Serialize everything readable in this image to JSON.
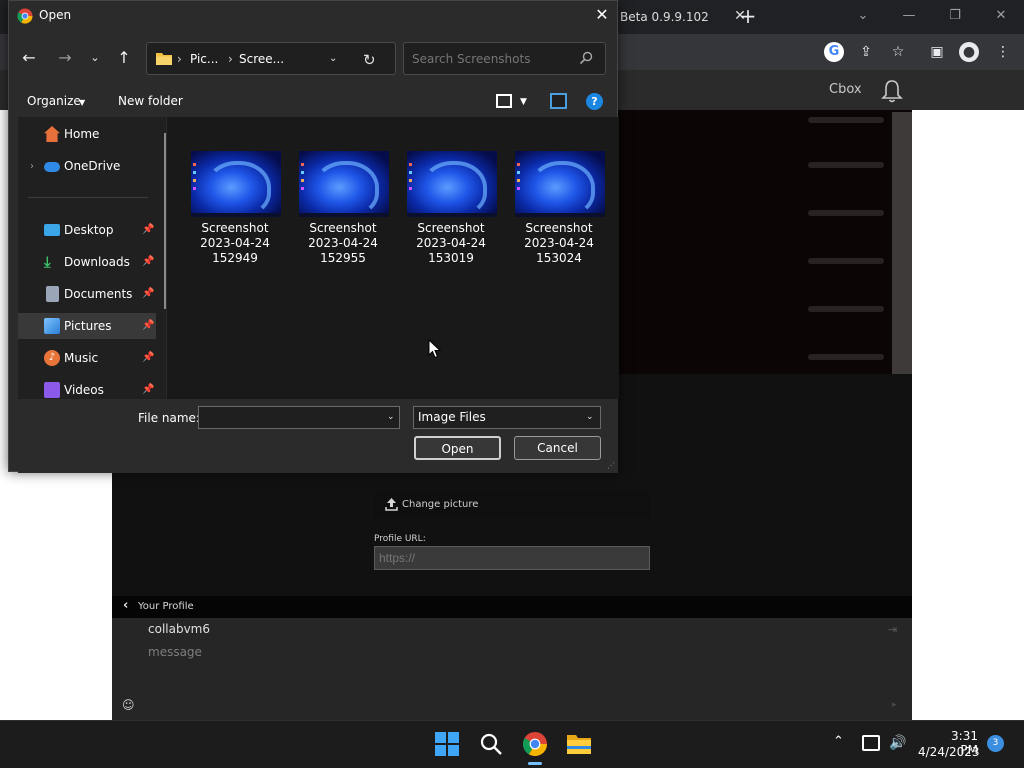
{
  "browser": {
    "tab_title": "Beta 0.9.9.102",
    "tab_close": "✕",
    "new_tab": "+",
    "window_controls": [
      "⌄",
      "—",
      "❐",
      "✕"
    ],
    "site": {
      "name": "Cbox"
    }
  },
  "page": {
    "change_picture": "Change picture",
    "profile_url_label": "Profile URL:",
    "profile_url_placeholder": "https://",
    "your_profile": "Your Profile",
    "chat": {
      "username": "collabvm6",
      "message_placeholder": "message"
    }
  },
  "dialog": {
    "title": "Open",
    "close": "✕",
    "breadcrumb": [
      "Pic...",
      "Scree..."
    ],
    "search_placeholder": "Search Screenshots",
    "organize": "Organize",
    "new_folder": "New folder",
    "help": "?",
    "nav_items": [
      {
        "label": "Home",
        "icon": "home-icon",
        "color": "#e8703a"
      },
      {
        "label": "OneDrive",
        "icon": "onedrive-icon",
        "color": "#2f8ae6"
      },
      {
        "label": "Desktop",
        "icon": "desktop-icon",
        "color": "#3aa6e8"
      },
      {
        "label": "Downloads",
        "icon": "downloads-icon",
        "color": "#3fbf6a"
      },
      {
        "label": "Documents",
        "icon": "documents-icon",
        "color": "#9aa6b8"
      },
      {
        "label": "Pictures",
        "icon": "pictures-icon",
        "color": "#3a9be8"
      },
      {
        "label": "Music",
        "icon": "music-icon",
        "color": "#e8743a"
      },
      {
        "label": "Videos",
        "icon": "videos-icon",
        "color": "#8c5ae8"
      }
    ],
    "files": [
      {
        "line1": "Screenshot",
        "line2": "2023-04-24",
        "line3": "152949"
      },
      {
        "line1": "Screenshot",
        "line2": "2023-04-24",
        "line3": "152955"
      },
      {
        "line1": "Screenshot",
        "line2": "2023-04-24",
        "line3": "153019"
      },
      {
        "line1": "Screenshot",
        "line2": "2023-04-24",
        "line3": "153024"
      }
    ],
    "file_name_label": "File name:",
    "file_name_value": "",
    "file_type": "Image Files",
    "open_button": "Open",
    "cancel_button": "Cancel"
  },
  "taskbar": {
    "time": "3:31 PM",
    "date": "4/24/2023",
    "notifications": "3"
  }
}
